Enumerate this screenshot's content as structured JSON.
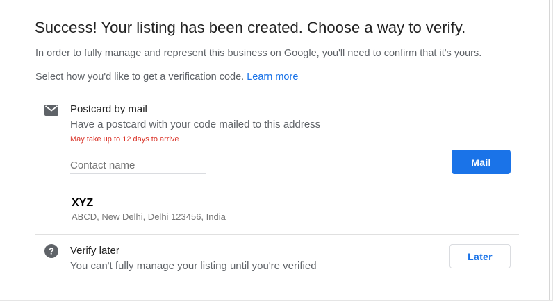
{
  "header": {
    "title": "Success! Your listing has been created. Choose a way to verify.",
    "intro": "In order to fully manage and represent this business on Google, you'll need to confirm that it's yours.",
    "select_prefix": "Select how you'd like to get a verification code.",
    "learn_more": "Learn more"
  },
  "postcard": {
    "icon": "mail-icon",
    "title": "Postcard by mail",
    "description": "Have a postcard with your code mailed to this address",
    "warning": "May take up to 12 days to arrive",
    "contact_placeholder": "Contact name",
    "contact_value": "",
    "button_label": "Mail",
    "business_name": "XYZ",
    "business_address": "ABCD, New Delhi, Delhi 123456, India"
  },
  "verify_later": {
    "icon": "help-icon",
    "title": "Verify later",
    "description": "You can't fully manage your listing until you're verified",
    "button_label": "Later"
  },
  "colors": {
    "accent": "#1a73e8",
    "warning": "#d93025",
    "text_primary": "#212121",
    "text_secondary": "#5f6368"
  }
}
